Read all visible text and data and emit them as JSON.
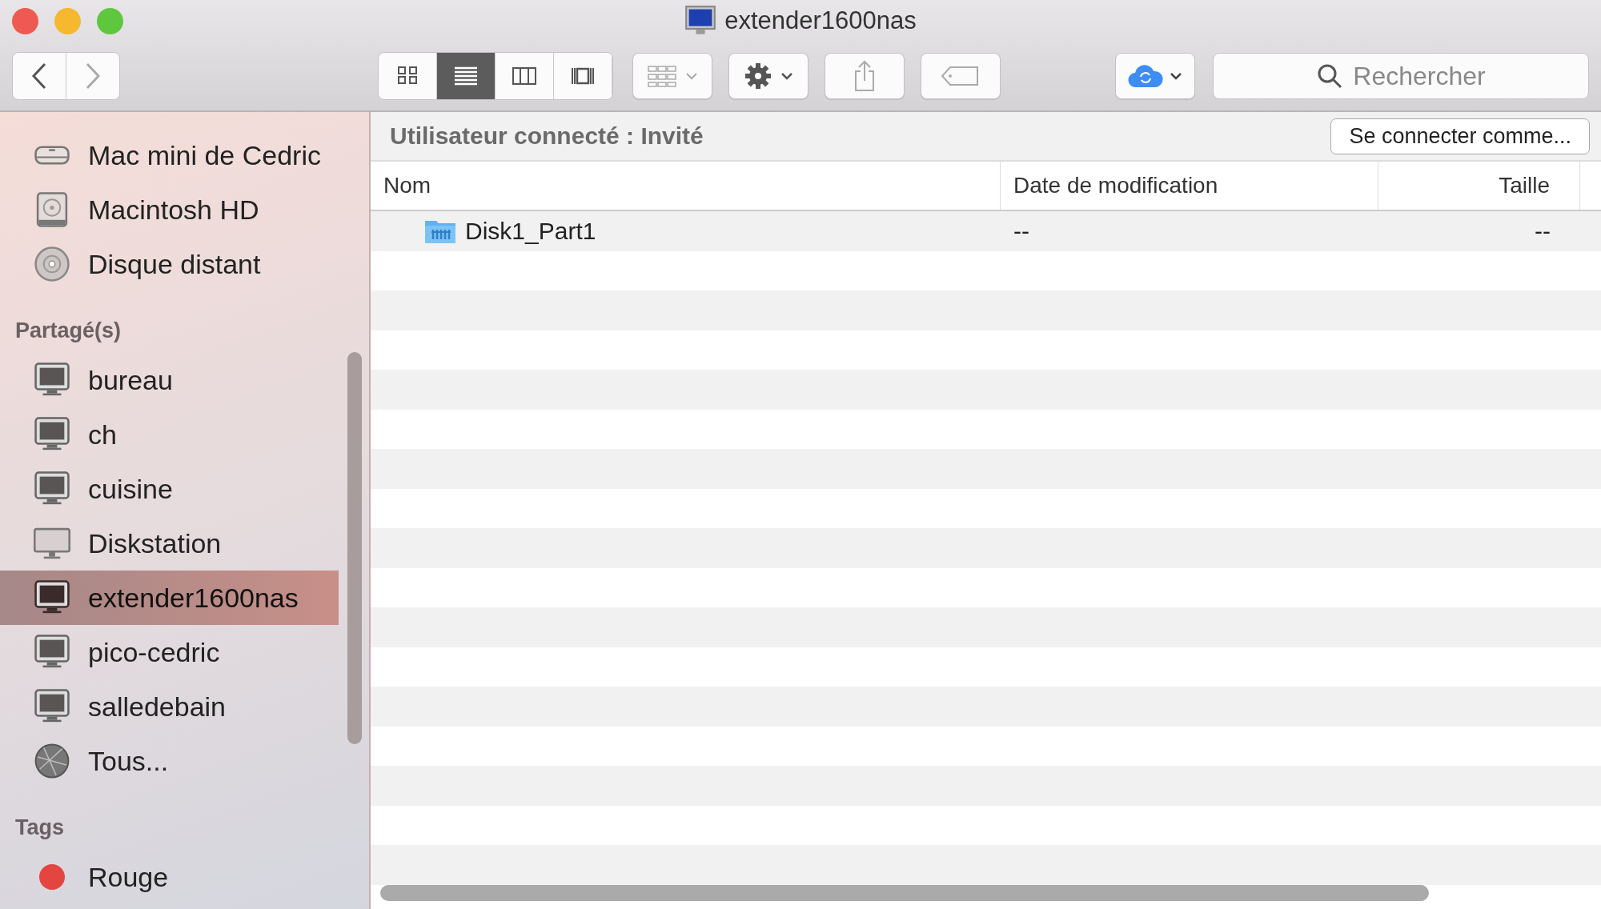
{
  "window": {
    "title": "extender1600nas"
  },
  "toolbar": {
    "view_modes": [
      {
        "kind": "icons",
        "selected": false
      },
      {
        "kind": "list",
        "selected": true
      },
      {
        "kind": "columns",
        "selected": false
      },
      {
        "kind": "coverflow",
        "selected": false
      }
    ],
    "search": {
      "placeholder": "Rechercher"
    }
  },
  "sidebar": {
    "sections": [
      {
        "items": [
          {
            "kind": "macmini",
            "label": "Mac mini de Cedric",
            "selected": false
          },
          {
            "kind": "harddisk",
            "label": "Macintosh HD",
            "selected": false
          },
          {
            "kind": "disc",
            "label": "Disque distant",
            "selected": false
          }
        ]
      },
      {
        "title": "Partagé(s)",
        "items": [
          {
            "kind": "monitor",
            "label": "bureau",
            "selected": false
          },
          {
            "kind": "monitor",
            "label": "ch",
            "selected": false
          },
          {
            "kind": "monitor",
            "label": "cuisine",
            "selected": false
          },
          {
            "kind": "display",
            "label": "Diskstation",
            "selected": false
          },
          {
            "kind": "monitor",
            "label": "extender1600nas",
            "selected": true
          },
          {
            "kind": "monitor",
            "label": "pico-cedric",
            "selected": false
          },
          {
            "kind": "monitor",
            "label": "salledebain",
            "selected": false
          },
          {
            "kind": "globe",
            "label": "Tous...",
            "selected": false
          }
        ]
      },
      {
        "title": "Tags",
        "items": [
          {
            "label": "Rouge",
            "color": "#e2463f",
            "selected": false
          }
        ]
      }
    ]
  },
  "connection_bar": {
    "status": "Utilisateur connecté : Invité",
    "button": "Se connecter comme..."
  },
  "table": {
    "columns": [
      "Nom",
      "Date de modification",
      "Taille"
    ],
    "rows": [
      {
        "kind": "folder",
        "name": "Disk1_Part1",
        "modified": "--",
        "size": "--"
      }
    ]
  }
}
